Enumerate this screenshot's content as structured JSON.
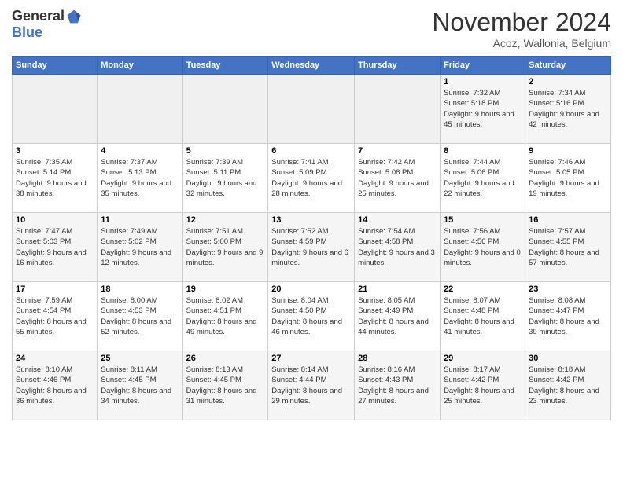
{
  "header": {
    "logo_general": "General",
    "logo_blue": "Blue",
    "month_title": "November 2024",
    "location": "Acoz, Wallonia, Belgium"
  },
  "weekdays": [
    "Sunday",
    "Monday",
    "Tuesday",
    "Wednesday",
    "Thursday",
    "Friday",
    "Saturday"
  ],
  "weeks": [
    [
      {
        "day": "",
        "sunrise": "",
        "sunset": "",
        "daylight": "",
        "empty": true
      },
      {
        "day": "",
        "sunrise": "",
        "sunset": "",
        "daylight": "",
        "empty": true
      },
      {
        "day": "",
        "sunrise": "",
        "sunset": "",
        "daylight": "",
        "empty": true
      },
      {
        "day": "",
        "sunrise": "",
        "sunset": "",
        "daylight": "",
        "empty": true
      },
      {
        "day": "",
        "sunrise": "",
        "sunset": "",
        "daylight": "",
        "empty": true
      },
      {
        "day": "1",
        "sunrise": "Sunrise: 7:32 AM",
        "sunset": "Sunset: 5:18 PM",
        "daylight": "Daylight: 9 hours and 45 minutes."
      },
      {
        "day": "2",
        "sunrise": "Sunrise: 7:34 AM",
        "sunset": "Sunset: 5:16 PM",
        "daylight": "Daylight: 9 hours and 42 minutes."
      }
    ],
    [
      {
        "day": "3",
        "sunrise": "Sunrise: 7:35 AM",
        "sunset": "Sunset: 5:14 PM",
        "daylight": "Daylight: 9 hours and 38 minutes."
      },
      {
        "day": "4",
        "sunrise": "Sunrise: 7:37 AM",
        "sunset": "Sunset: 5:13 PM",
        "daylight": "Daylight: 9 hours and 35 minutes."
      },
      {
        "day": "5",
        "sunrise": "Sunrise: 7:39 AM",
        "sunset": "Sunset: 5:11 PM",
        "daylight": "Daylight: 9 hours and 32 minutes."
      },
      {
        "day": "6",
        "sunrise": "Sunrise: 7:41 AM",
        "sunset": "Sunset: 5:09 PM",
        "daylight": "Daylight: 9 hours and 28 minutes."
      },
      {
        "day": "7",
        "sunrise": "Sunrise: 7:42 AM",
        "sunset": "Sunset: 5:08 PM",
        "daylight": "Daylight: 9 hours and 25 minutes."
      },
      {
        "day": "8",
        "sunrise": "Sunrise: 7:44 AM",
        "sunset": "Sunset: 5:06 PM",
        "daylight": "Daylight: 9 hours and 22 minutes."
      },
      {
        "day": "9",
        "sunrise": "Sunrise: 7:46 AM",
        "sunset": "Sunset: 5:05 PM",
        "daylight": "Daylight: 9 hours and 19 minutes."
      }
    ],
    [
      {
        "day": "10",
        "sunrise": "Sunrise: 7:47 AM",
        "sunset": "Sunset: 5:03 PM",
        "daylight": "Daylight: 9 hours and 16 minutes."
      },
      {
        "day": "11",
        "sunrise": "Sunrise: 7:49 AM",
        "sunset": "Sunset: 5:02 PM",
        "daylight": "Daylight: 9 hours and 12 minutes."
      },
      {
        "day": "12",
        "sunrise": "Sunrise: 7:51 AM",
        "sunset": "Sunset: 5:00 PM",
        "daylight": "Daylight: 9 hours and 9 minutes."
      },
      {
        "day": "13",
        "sunrise": "Sunrise: 7:52 AM",
        "sunset": "Sunset: 4:59 PM",
        "daylight": "Daylight: 9 hours and 6 minutes."
      },
      {
        "day": "14",
        "sunrise": "Sunrise: 7:54 AM",
        "sunset": "Sunset: 4:58 PM",
        "daylight": "Daylight: 9 hours and 3 minutes."
      },
      {
        "day": "15",
        "sunrise": "Sunrise: 7:56 AM",
        "sunset": "Sunset: 4:56 PM",
        "daylight": "Daylight: 9 hours and 0 minutes."
      },
      {
        "day": "16",
        "sunrise": "Sunrise: 7:57 AM",
        "sunset": "Sunset: 4:55 PM",
        "daylight": "Daylight: 8 hours and 57 minutes."
      }
    ],
    [
      {
        "day": "17",
        "sunrise": "Sunrise: 7:59 AM",
        "sunset": "Sunset: 4:54 PM",
        "daylight": "Daylight: 8 hours and 55 minutes."
      },
      {
        "day": "18",
        "sunrise": "Sunrise: 8:00 AM",
        "sunset": "Sunset: 4:53 PM",
        "daylight": "Daylight: 8 hours and 52 minutes."
      },
      {
        "day": "19",
        "sunrise": "Sunrise: 8:02 AM",
        "sunset": "Sunset: 4:51 PM",
        "daylight": "Daylight: 8 hours and 49 minutes."
      },
      {
        "day": "20",
        "sunrise": "Sunrise: 8:04 AM",
        "sunset": "Sunset: 4:50 PM",
        "daylight": "Daylight: 8 hours and 46 minutes."
      },
      {
        "day": "21",
        "sunrise": "Sunrise: 8:05 AM",
        "sunset": "Sunset: 4:49 PM",
        "daylight": "Daylight: 8 hours and 44 minutes."
      },
      {
        "day": "22",
        "sunrise": "Sunrise: 8:07 AM",
        "sunset": "Sunset: 4:48 PM",
        "daylight": "Daylight: 8 hours and 41 minutes."
      },
      {
        "day": "23",
        "sunrise": "Sunrise: 8:08 AM",
        "sunset": "Sunset: 4:47 PM",
        "daylight": "Daylight: 8 hours and 39 minutes."
      }
    ],
    [
      {
        "day": "24",
        "sunrise": "Sunrise: 8:10 AM",
        "sunset": "Sunset: 4:46 PM",
        "daylight": "Daylight: 8 hours and 36 minutes."
      },
      {
        "day": "25",
        "sunrise": "Sunrise: 8:11 AM",
        "sunset": "Sunset: 4:45 PM",
        "daylight": "Daylight: 8 hours and 34 minutes."
      },
      {
        "day": "26",
        "sunrise": "Sunrise: 8:13 AM",
        "sunset": "Sunset: 4:45 PM",
        "daylight": "Daylight: 8 hours and 31 minutes."
      },
      {
        "day": "27",
        "sunrise": "Sunrise: 8:14 AM",
        "sunset": "Sunset: 4:44 PM",
        "daylight": "Daylight: 8 hours and 29 minutes."
      },
      {
        "day": "28",
        "sunrise": "Sunrise: 8:16 AM",
        "sunset": "Sunset: 4:43 PM",
        "daylight": "Daylight: 8 hours and 27 minutes."
      },
      {
        "day": "29",
        "sunrise": "Sunrise: 8:17 AM",
        "sunset": "Sunset: 4:42 PM",
        "daylight": "Daylight: 8 hours and 25 minutes."
      },
      {
        "day": "30",
        "sunrise": "Sunrise: 8:18 AM",
        "sunset": "Sunset: 4:42 PM",
        "daylight": "Daylight: 8 hours and 23 minutes."
      }
    ]
  ]
}
